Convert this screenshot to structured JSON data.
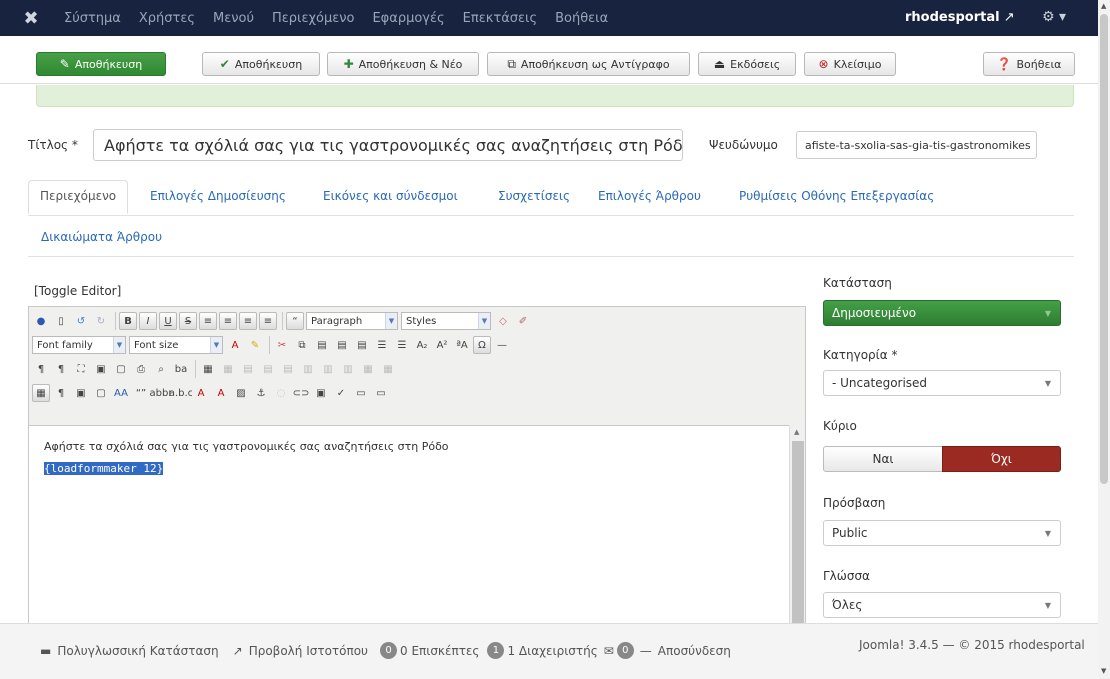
{
  "topnav": {
    "items": [
      "Σύστημα",
      "Χρήστες",
      "Μενού",
      "Περιεχόμενο",
      "Εφαρμογές",
      "Επεκτάσεις",
      "Βοήθεια"
    ],
    "site": "rhodesportal"
  },
  "toolbar": {
    "save_primary": "Αποθήκευση",
    "save": "Αποθήκευση",
    "save_new": "Αποθήκευση & Νέο",
    "save_copy": "Αποθήκευση ως Αντίγραφο",
    "versions": "Εκδόσεις",
    "close": "Κλείσιμο",
    "help": "Βοήθεια"
  },
  "title": {
    "label": "Τίτλος *",
    "value": "Αφήστε τα σχόλιά σας για τις γαστρονομικές σας αναζητήσεις στη Ρόδο",
    "alias_label": "Ψευδώνυμο",
    "alias_value": "afiste-ta-sxolia-sas-gia-tis-gastronomikes"
  },
  "tabs": [
    "Περιεχόμενο",
    "Επιλογές Δημοσίευσης",
    "Εικόνες και σύνδεσμοι",
    "Συσχετίσεις",
    "Επιλογές Άρθρου",
    "Ρυθμίσεις Οθόνης Επεξεργασίας",
    "Δικαιώματα Άρθρου"
  ],
  "editor": {
    "toggle": "[Toggle Editor]",
    "format": "Paragraph",
    "styles": "Styles",
    "font_family": "Font family",
    "font_size": "Font size",
    "content_line": "Αφήστε τα σχόλιά σας για τις γαστρονομικές σας αναζητήσεις στη Ρόδο",
    "selected": "{loadformmaker 12}"
  },
  "sidebar": {
    "status_label": "Κατάσταση",
    "status_value": "Δημοσιευμένο",
    "category_label": "Κατηγορία *",
    "category_value": "- Uncategorised",
    "featured_label": "Κύριο",
    "yes": "Ναι",
    "no": "Όχι",
    "access_label": "Πρόσβαση",
    "access_value": "Public",
    "language_label": "Γλώσσα",
    "language_value": "Όλες"
  },
  "footer": {
    "multilang": "Πολυγλωσσική Κατάσταση",
    "view_site": "Προβολή Ιστοτόπου",
    "visitors_count": "0",
    "visitors": "0 Επισκέπτες",
    "admins_count": "1",
    "admins": "1 Διαχειριστής",
    "messages_count": "0",
    "logout": "Αποσύνδεση",
    "version": "Joomla! 3.4.5 — © 2015 rhodesportal"
  },
  "colors": {
    "nav": "#17233f",
    "green": "#2f8a32",
    "red": "#9a2a22",
    "link": "#2a69b8"
  }
}
